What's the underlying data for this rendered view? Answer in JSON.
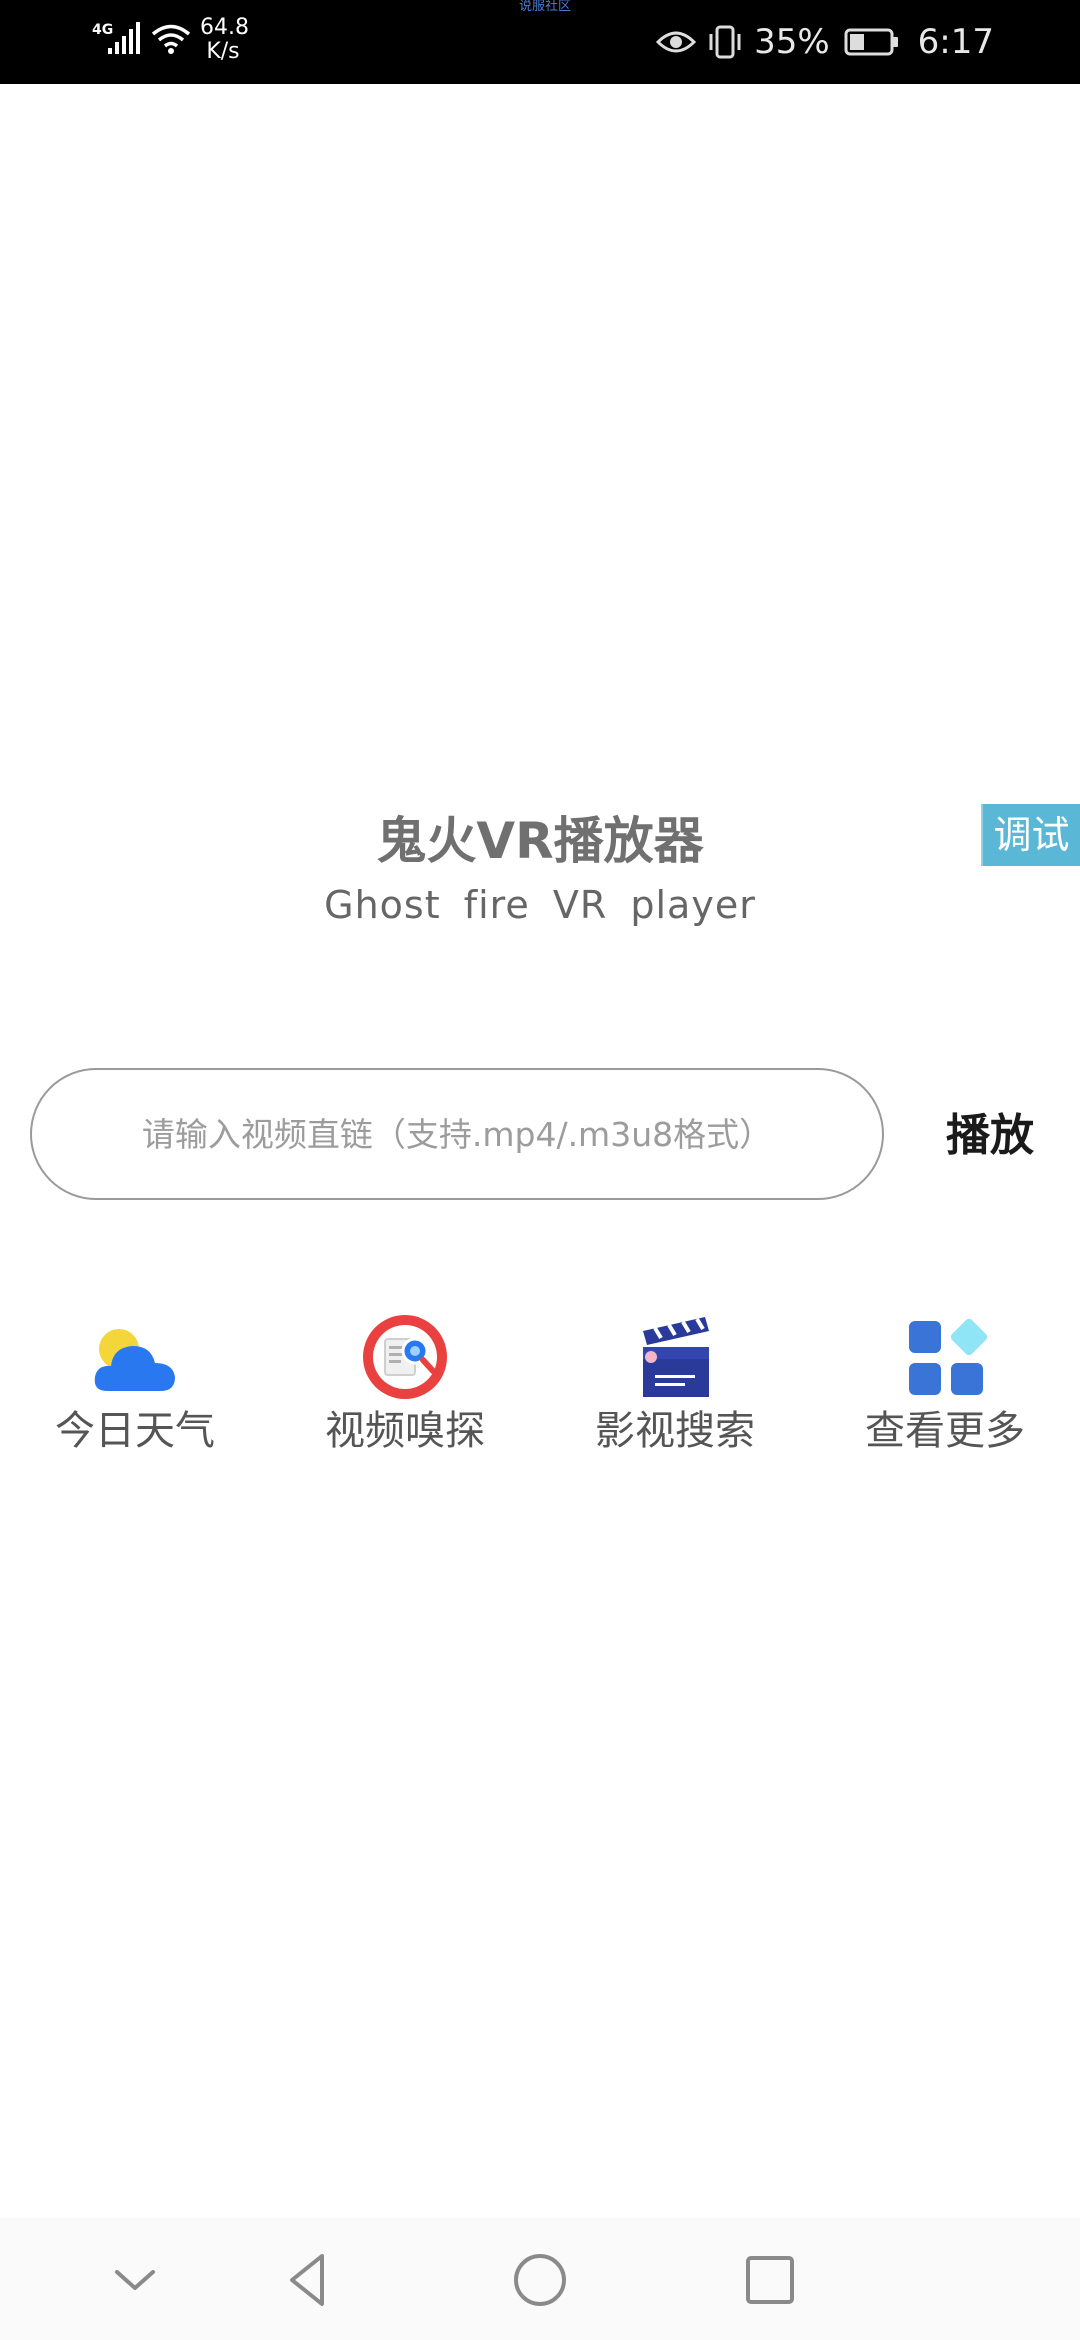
{
  "status_bar": {
    "carrier_label": "说服社区",
    "network_gen": "4G",
    "net_speed_value": "64.8",
    "net_speed_unit": "K/s",
    "battery_percent": "35%",
    "time": "6:17",
    "icons": [
      "signal-icon",
      "wifi-icon",
      "eye-icon",
      "vibrate-icon",
      "battery-icon"
    ]
  },
  "main": {
    "title": "鬼火VR播放器",
    "subtitle": "Ghost fire VR player",
    "debug_label": "调试",
    "url_input": {
      "value": "",
      "placeholder": "请输入视频直链（支持.mp4/.m3u8格式）"
    },
    "play_label": "播放",
    "shortcuts": [
      {
        "label": "今日天气",
        "icon": "weather-icon"
      },
      {
        "label": "视频嗅探",
        "icon": "video-sniff-icon"
      },
      {
        "label": "影视搜索",
        "icon": "movie-search-icon"
      },
      {
        "label": "查看更多",
        "icon": "more-grid-icon"
      }
    ]
  },
  "nav_bar": {
    "buttons": [
      "hide-nav-icon",
      "back-icon",
      "home-icon",
      "recents-icon"
    ]
  },
  "colors": {
    "accent_debug": "#5ab8d6",
    "weather_sun": "#f5d63a",
    "weather_cloud": "#2a78f0",
    "sniff_ring": "#e94040",
    "movie_blue": "#2a3a9a",
    "grid_blue": "#3a74d6",
    "grid_cyan": "#8fe4f5"
  }
}
